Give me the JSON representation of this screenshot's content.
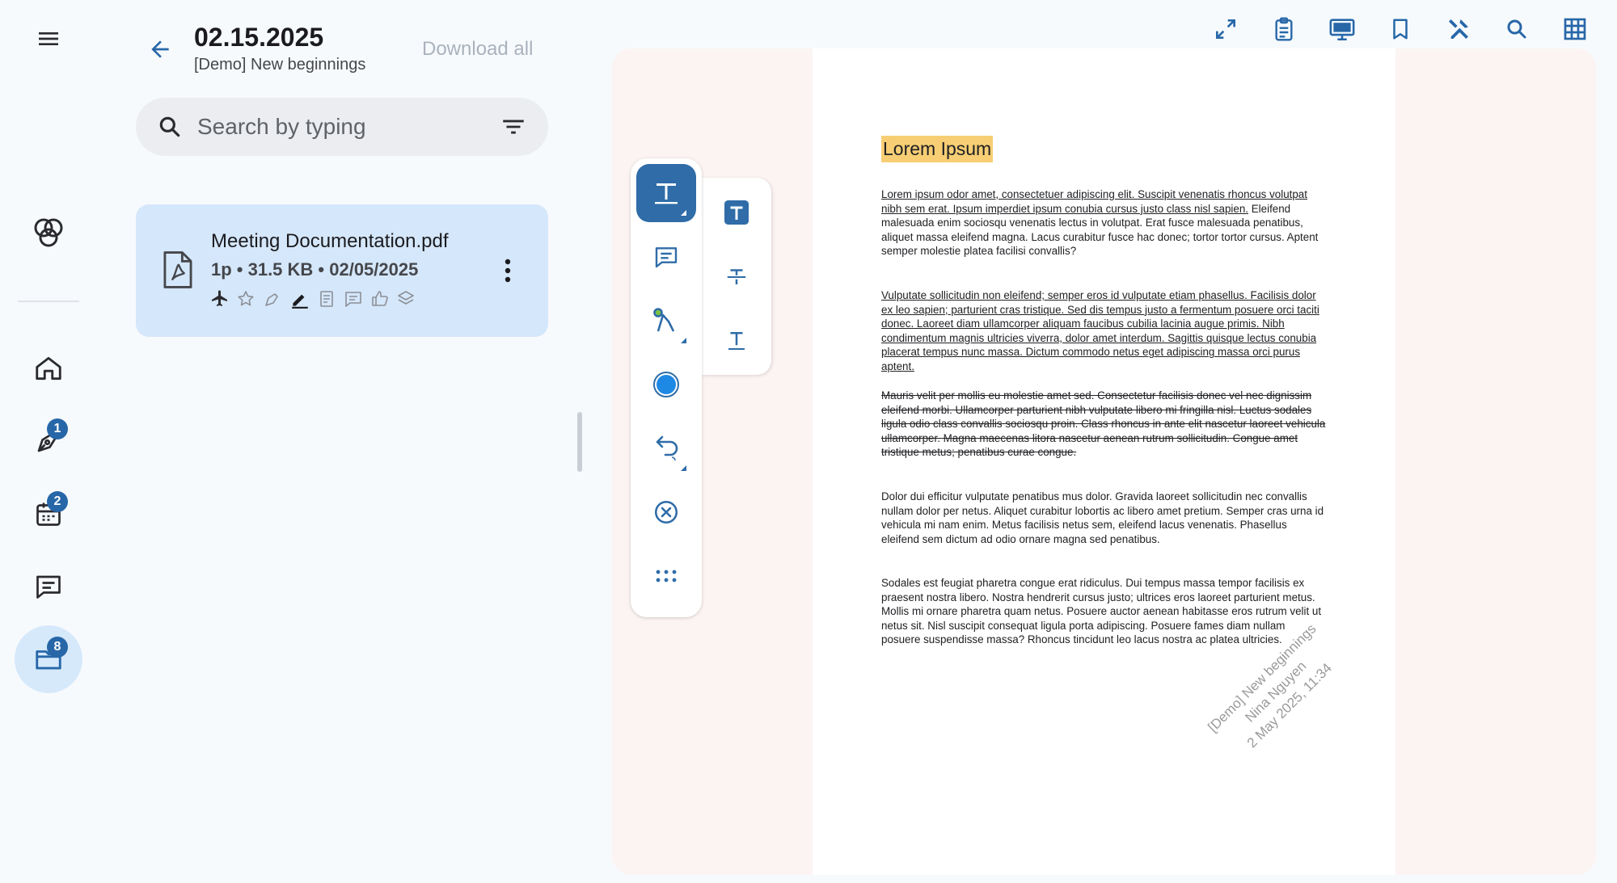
{
  "header": {
    "title": "02.15.2025",
    "subtitle": "[Demo] New beginnings",
    "download_all": "Download all"
  },
  "search": {
    "placeholder": "Search by typing"
  },
  "rail": {
    "badges": {
      "sign": "1",
      "calendar": "2",
      "files": "8"
    },
    "icons": [
      "menu-icon",
      "app-logo-icon",
      "home-icon",
      "pen-icon",
      "calendar-icon",
      "comment-icon",
      "folder-icon"
    ]
  },
  "file": {
    "name": "Meeting Documentation.pdf",
    "meta": "1p • 31.5 KB • 02/05/2025",
    "tool_icons": [
      "airplane-icon",
      "star-icon",
      "signature-icon",
      "edit-icon",
      "note-icon",
      "comment-icon",
      "thumbs-up-icon",
      "layers-icon"
    ]
  },
  "toolbar": {
    "icons": [
      "expand-icon",
      "clipboard-icon",
      "monitor-icon",
      "bookmark-icon",
      "tools-icon",
      "search-icon",
      "grid-icon"
    ],
    "accent_color": "#2767a8"
  },
  "document": {
    "heading": "Lorem Ipsum",
    "p1_underlined": "Lorem ipsum odor amet, consectetuer adipiscing elit. Suscipit venenatis rhoncus volutpat nibh sem erat. Ipsum imperdiet ipsum conubia cursus justo class nisl sapien.",
    "p1_rest": " Eleifend malesuada enim sociosqu venenatis lectus in volutpat. Erat fusce malesuada penatibus, aliquet massa eleifend magna. Lacus curabitur fusce hac donec; tortor tortor cursus. Aptent semper molestie platea facilisi convallis?",
    "p2": "Vulputate sollicitudin non eleifend; semper eros id vulputate etiam phasellus. Facilisis dolor ex leo sapien; parturient cras tristique. Sed dis tempus justo a fermentum posuere orci taciti donec. Laoreet diam ullamcorper aliquam faucibus cubilia lacinia augue primis. Nibh condimentum magnis ultricies viverra, dolor amet interdum. Sagittis quisque lectus conubia placerat tempus nunc massa. Dictum commodo netus eget adipiscing massa orci purus aptent.",
    "p3": "Mauris velit per mollis eu molestie amet sed. Consectetur facilisis donec vel nec dignissim eleifend morbi. Ullamcorper parturient nibh vulputate libero mi fringilla nisl. Luctus sodales ligula odio class convallis sociosqu proin. Class rhoncus in ante elit nascetur laoreet vehicula ullamcorper. Magna maecenas litora nascetur aenean rutrum sollicitudin. Congue amet tristique metus; penatibus curae congue.",
    "p4": "Dolor dui efficitur vulputate penatibus mus dolor. Gravida laoreet sollicitudin nec convallis nullam dolor per netus. Aliquet curabitur lobortis ac libero amet pretium. Semper cras urna id vehicula mi nam enim. Metus facilisis netus sem, eleifend lacus venenatis. Phasellus eleifend sem dictum ad odio ornare magna sed penatibus.",
    "p5": "Sodales est feugiat pharetra congue erat ridiculus. Dui tempus massa tempor facilisis ex praesent nostra libero. Nostra hendrerit cursus justo; ultrices eros laoreet parturient metus. Mollis mi ornare pharetra quam netus. Posuere auctor aenean habitasse eros rutrum velit ut netus sit. Nisl suscipit consequat ligula porta adipiscing. Posuere fames diam nullam posuere suspendisse massa? Rhoncus tincidunt leo lacus nostra ac platea ultricies.",
    "watermark_line1": "[Demo] New beginnings",
    "watermark_line2": "Nina Nguyen",
    "watermark_line3": "2 May 2025, 11:34"
  },
  "annotation_toolbar": {
    "tools": [
      "text-markup-icon",
      "comment-icon",
      "draw-icon",
      "color-icon",
      "undo-redo-icon",
      "clear-icon",
      "more-icon"
    ],
    "sub_tools": [
      "text-box-icon",
      "strikethrough-icon",
      "underline-icon"
    ],
    "color": "#1e88e5"
  }
}
